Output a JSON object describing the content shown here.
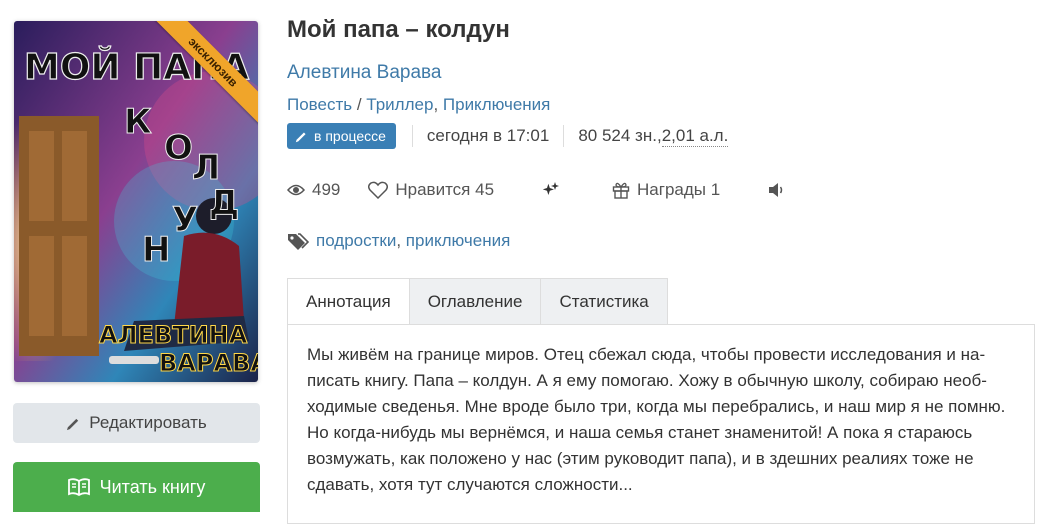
{
  "cover": {
    "badge": "эксклюзив",
    "title_lines": [
      "МОЙ ПАПА",
      "К",
      "О",
      "Л",
      "Д",
      "У",
      "Н"
    ],
    "author_lines": [
      "АЛЕВТИНА",
      "ВАРАВА"
    ]
  },
  "actions": {
    "edit_label": "Редактировать",
    "read_label": "Читать книгу"
  },
  "book": {
    "title": "Мой папа – колдун",
    "author": "Алевтина Варава",
    "form": "Повесть",
    "genre_sep": " / ",
    "genres": [
      "Триллер",
      "Приключения"
    ],
    "status": "в процессе",
    "updated": "сегодня в 17:01",
    "size_chars": "80 524 зн., ",
    "size_al": "2,01 а.л."
  },
  "stats": {
    "views": "499",
    "likes": "Нравится 45",
    "awards": "Награды 1"
  },
  "tags": [
    "подростки",
    "приключения"
  ],
  "tabs": [
    "Аннотация",
    "Оглавление",
    "Статистика"
  ],
  "annotation": "Мы живём на границе миров. Отец сбежал сюда, чтобы провести исследования и на­писать книгу. Папа – колдун. А я ему помогаю. Хожу в обычную школу, собираю необ­ходимые сведенья. Мне вроде было три, когда мы перебрались, и наш мир я не по­мню. Но когда-нибудь мы вернёмся, и наша семья станет знаменитой! А пока я стара­юсь возмужать, как положено у нас (этим руководит папа), и в здешних реалиях тоже не сдавать, хотя тут случаются сложности...",
  "colors": {
    "link": "#3f7aa8",
    "badge": "#3a7fb5",
    "read_button": "#4cae4c",
    "ribbon": "#f0a52a"
  }
}
